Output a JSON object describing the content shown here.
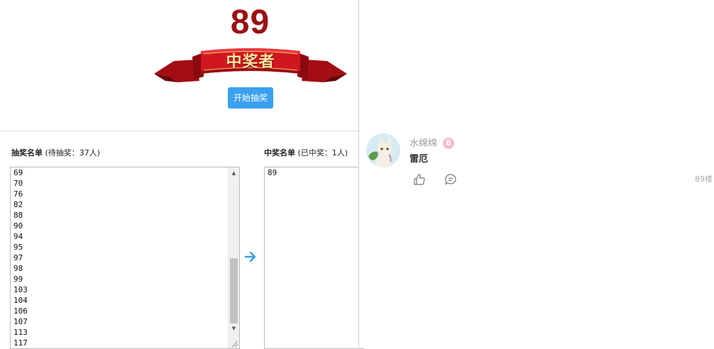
{
  "lottery": {
    "winner_number": "89",
    "ribbon_title": "中奖者",
    "start_button": "开始抽奖",
    "pool_list": {
      "title": "抽奖名单",
      "status": "(待抽奖：37人)",
      "visible_entries": [
        "69",
        "70",
        "76",
        "82",
        "88",
        "90",
        "94",
        "95",
        "97",
        "98",
        "99",
        "103",
        "104",
        "106",
        "107",
        "113",
        "117"
      ]
    },
    "winner_list": {
      "title": "中奖名单",
      "status": "(已中奖：1人)",
      "visible_entries": [
        "89"
      ]
    },
    "colors": {
      "winner_number": "#9b1111",
      "ribbon": "#c8141c",
      "ribbon_text": "#ffe7a0",
      "button": "#3aa0f0",
      "arrow": "#36a3dc"
    },
    "transfer_icon": "arrow-right-icon"
  },
  "comment": {
    "username": "水绵绵",
    "level": "8",
    "text": "雷厄",
    "floor": "89楼",
    "icons": [
      "avatar",
      "thumbs-up-icon",
      "reply-icon"
    ],
    "colors": {
      "username": "#9a9a9a",
      "level_badge": "#f7bcc6"
    }
  }
}
